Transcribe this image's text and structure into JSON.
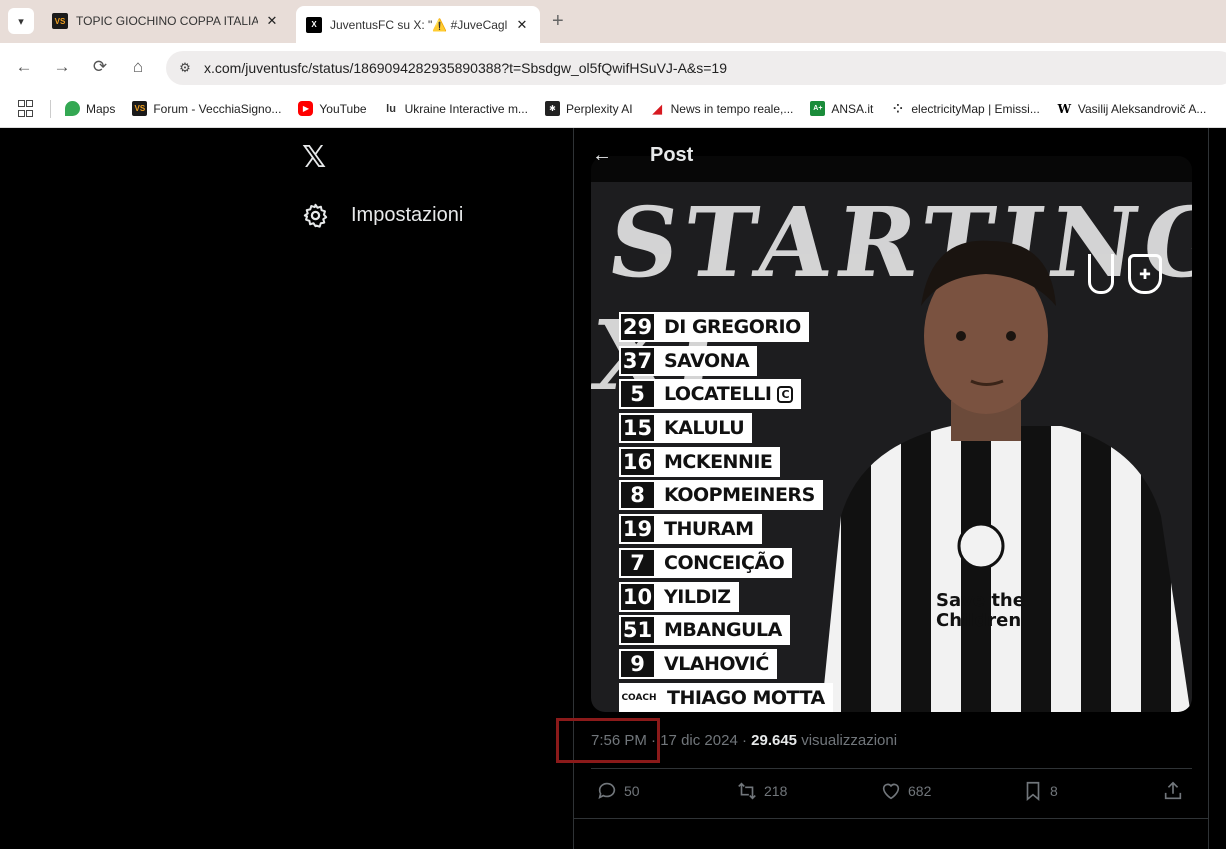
{
  "browser": {
    "tabs": [
      {
        "favicon": "VS",
        "title": "TOPIC GIOCHINO COPPA ITALIA: J"
      },
      {
        "favicon": "X",
        "title": "JuventusFC su X: \"⚠️ #JuveCaglia"
      }
    ],
    "new_tab": "+",
    "url": "x.com/juventusfc/status/1869094282935890388?t=Sbsdgw_ol5fQwifHSuVJ-A&s=19",
    "bookmarks": [
      {
        "label": "Maps",
        "icon": "maps-pin-icon",
        "color": "#34a853"
      },
      {
        "label": "Forum - VecchiaSigno...",
        "icon": "VS",
        "color": "#1a1a1a"
      },
      {
        "label": "YouTube",
        "icon": "youtube-icon",
        "color": "#ff0000"
      },
      {
        "label": "Ukraine Interactive m...",
        "icon": "lu-icon",
        "color": "#333333"
      },
      {
        "label": "Perplexity AI",
        "icon": "perplexity-icon",
        "color": "#222222"
      },
      {
        "label": "News in tempo reale,...",
        "icon": "news-icon",
        "color": "#d71920"
      },
      {
        "label": "ANSA.it",
        "icon": "ANSA",
        "color": "#1a8c3a"
      },
      {
        "label": "electricityMap | Emissi...",
        "icon": "electricity-icon",
        "color": "#333333"
      },
      {
        "label": "Vasilij Aleksandrovič A...",
        "icon": "W",
        "color": "#000000"
      }
    ]
  },
  "sidebar": {
    "logo": "𝕏",
    "settings_label": "Impostazioni"
  },
  "post": {
    "header_title": "Post",
    "lineup": [
      {
        "num": "29",
        "name": "DI GREGORIO"
      },
      {
        "num": "37",
        "name": "SAVONA"
      },
      {
        "num": "5",
        "name": "LOCATELLI",
        "captain": "C"
      },
      {
        "num": "15",
        "name": "KALULU"
      },
      {
        "num": "16",
        "name": "MCKENNIE"
      },
      {
        "num": "8",
        "name": "KOOPMEINERS"
      },
      {
        "num": "19",
        "name": "THURAM"
      },
      {
        "num": "7",
        "name": "CONCEIÇÃO"
      },
      {
        "num": "10",
        "name": "YILDIZ"
      },
      {
        "num": "51",
        "name": "MBANGULA"
      },
      {
        "num": "9",
        "name": "VLAHOVIĆ"
      },
      {
        "num": "COACH",
        "name": "THIAGO MOTTA"
      }
    ],
    "time": "7:56 PM",
    "date": "17 dic 2024",
    "views_count": "29.645",
    "views_label": "visualizzazioni",
    "sep": "·",
    "actions": {
      "replies": "50",
      "reposts": "218",
      "likes": "682",
      "bookmarks": "8"
    }
  },
  "colors": {
    "highlight": "#8b1a1a",
    "text_primary": "#e7e9ea",
    "text_secondary": "#71767b"
  }
}
